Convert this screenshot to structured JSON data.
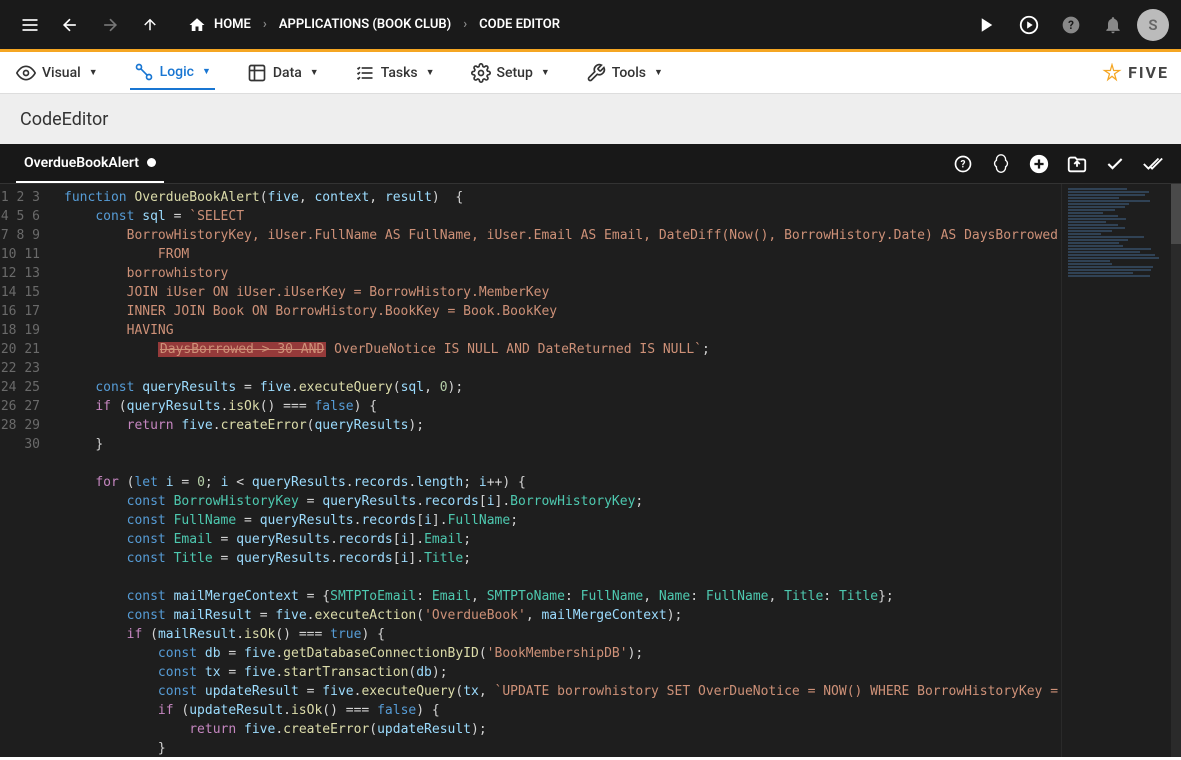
{
  "topbar": {
    "breadcrumb": [
      {
        "icon": "home",
        "label": "HOME"
      },
      {
        "label": "APPLICATIONS (BOOK CLUB)"
      },
      {
        "label": "CODE EDITOR"
      }
    ],
    "avatar_letter": "S"
  },
  "menubar": {
    "items": [
      {
        "icon": "eye",
        "label": "Visual"
      },
      {
        "icon": "nodes",
        "label": "Logic",
        "active": true
      },
      {
        "icon": "grid",
        "label": "Data"
      },
      {
        "icon": "tasks",
        "label": "Tasks"
      },
      {
        "icon": "gear",
        "label": "Setup"
      },
      {
        "icon": "tools",
        "label": "Tools"
      }
    ],
    "logo": "FIVE"
  },
  "subheader": "CodeEditor",
  "editor": {
    "tab": "OverdueBookAlert",
    "lineStart": 1,
    "lineEnd": 30,
    "code": [
      {
        "indent": 0,
        "tokens": [
          [
            "k",
            "function "
          ],
          [
            "fnn",
            "OverdueBookAlert"
          ],
          [
            "op",
            "("
          ],
          [
            "p",
            "five"
          ],
          [
            "op",
            ", "
          ],
          [
            "p",
            "context"
          ],
          [
            "op",
            ", "
          ],
          [
            "p",
            "result"
          ],
          [
            "op",
            ")  {"
          ]
        ]
      },
      {
        "indent": 1,
        "tokens": [
          [
            "k",
            "const "
          ],
          [
            "p",
            "sql"
          ],
          [
            "op",
            " = "
          ],
          [
            "s",
            "`SELECT"
          ]
        ]
      },
      {
        "indent": 2,
        "tokens": [
          [
            "s",
            "BorrowHistoryKey, iUser.FullName AS FullName, iUser.Email AS Email, DateDiff(Now(), BorrowHistory.Date) AS DaysBorrowed"
          ]
        ]
      },
      {
        "indent": 3,
        "tokens": [
          [
            "s",
            "FROM"
          ]
        ]
      },
      {
        "indent": 2,
        "tokens": [
          [
            "s",
            "borrowhistory"
          ]
        ]
      },
      {
        "indent": 2,
        "tokens": [
          [
            "s",
            "JOIN iUser ON iUser.iUserKey = BorrowHistory.MemberKey"
          ]
        ]
      },
      {
        "indent": 2,
        "tokens": [
          [
            "s",
            "INNER JOIN Book ON BorrowHistory.BookKey = Book.BookKey"
          ]
        ]
      },
      {
        "indent": 2,
        "tokens": [
          [
            "s",
            "HAVING"
          ]
        ]
      },
      {
        "indent": 3,
        "tokens": [
          [
            "sel",
            "DaysBorrowed > 30 AND"
          ],
          [
            "s",
            " OverDueNotice IS NULL AND DateReturned IS NULL`"
          ],
          [
            "op",
            ";"
          ]
        ]
      },
      {
        "indent": 0,
        "tokens": []
      },
      {
        "indent": 1,
        "tokens": [
          [
            "k",
            "const "
          ],
          [
            "p",
            "queryResults"
          ],
          [
            "op",
            " = "
          ],
          [
            "p",
            "five"
          ],
          [
            "op",
            "."
          ],
          [
            "fnn",
            "executeQuery"
          ],
          [
            "op",
            "("
          ],
          [
            "p",
            "sql"
          ],
          [
            "op",
            ", "
          ],
          [
            "n",
            "0"
          ],
          [
            "op",
            ");"
          ]
        ]
      },
      {
        "indent": 1,
        "tokens": [
          [
            "kw",
            "if"
          ],
          [
            "op",
            " ("
          ],
          [
            "p",
            "queryResults"
          ],
          [
            "op",
            "."
          ],
          [
            "fnn",
            "isOk"
          ],
          [
            "op",
            "() === "
          ],
          [
            "b",
            "false"
          ],
          [
            "op",
            ") {"
          ]
        ]
      },
      {
        "indent": 2,
        "tokens": [
          [
            "kw",
            "return"
          ],
          [
            "op",
            " "
          ],
          [
            "p",
            "five"
          ],
          [
            "op",
            "."
          ],
          [
            "fnn",
            "createError"
          ],
          [
            "op",
            "("
          ],
          [
            "p",
            "queryResults"
          ],
          [
            "op",
            ");"
          ]
        ]
      },
      {
        "indent": 1,
        "tokens": [
          [
            "op",
            "}"
          ]
        ]
      },
      {
        "indent": 0,
        "tokens": []
      },
      {
        "indent": 1,
        "tokens": [
          [
            "kw",
            "for"
          ],
          [
            "op",
            " ("
          ],
          [
            "k",
            "let "
          ],
          [
            "p",
            "i"
          ],
          [
            "op",
            " = "
          ],
          [
            "n",
            "0"
          ],
          [
            "op",
            "; "
          ],
          [
            "p",
            "i"
          ],
          [
            "op",
            " < "
          ],
          [
            "p",
            "queryResults"
          ],
          [
            "op",
            "."
          ],
          [
            "p",
            "records"
          ],
          [
            "op",
            "."
          ],
          [
            "p",
            "length"
          ],
          [
            "op",
            "; "
          ],
          [
            "p",
            "i"
          ],
          [
            "op",
            "++) {"
          ]
        ]
      },
      {
        "indent": 2,
        "tokens": [
          [
            "k",
            "const "
          ],
          [
            "m",
            "BorrowHistoryKey"
          ],
          [
            "op",
            " = "
          ],
          [
            "p",
            "queryResults"
          ],
          [
            "op",
            "."
          ],
          [
            "p",
            "records"
          ],
          [
            "op",
            "["
          ],
          [
            "p",
            "i"
          ],
          [
            "op",
            "]."
          ],
          [
            "m",
            "BorrowHistoryKey"
          ],
          [
            "op",
            ";"
          ]
        ]
      },
      {
        "indent": 2,
        "tokens": [
          [
            "k",
            "const "
          ],
          [
            "m",
            "FullName"
          ],
          [
            "op",
            " = "
          ],
          [
            "p",
            "queryResults"
          ],
          [
            "op",
            "."
          ],
          [
            "p",
            "records"
          ],
          [
            "op",
            "["
          ],
          [
            "p",
            "i"
          ],
          [
            "op",
            "]."
          ],
          [
            "m",
            "FullName"
          ],
          [
            "op",
            ";"
          ]
        ]
      },
      {
        "indent": 2,
        "tokens": [
          [
            "k",
            "const "
          ],
          [
            "m",
            "Email"
          ],
          [
            "op",
            " = "
          ],
          [
            "p",
            "queryResults"
          ],
          [
            "op",
            "."
          ],
          [
            "p",
            "records"
          ],
          [
            "op",
            "["
          ],
          [
            "p",
            "i"
          ],
          [
            "op",
            "]."
          ],
          [
            "m",
            "Email"
          ],
          [
            "op",
            ";"
          ]
        ]
      },
      {
        "indent": 2,
        "tokens": [
          [
            "k",
            "const "
          ],
          [
            "m",
            "Title"
          ],
          [
            "op",
            " = "
          ],
          [
            "p",
            "queryResults"
          ],
          [
            "op",
            "."
          ],
          [
            "p",
            "records"
          ],
          [
            "op",
            "["
          ],
          [
            "p",
            "i"
          ],
          [
            "op",
            "]."
          ],
          [
            "m",
            "Title"
          ],
          [
            "op",
            ";"
          ]
        ]
      },
      {
        "indent": 0,
        "tokens": []
      },
      {
        "indent": 2,
        "tokens": [
          [
            "k",
            "const "
          ],
          [
            "p",
            "mailMergeContext"
          ],
          [
            "op",
            " = {"
          ],
          [
            "m",
            "SMTPToEmail"
          ],
          [
            "op",
            ": "
          ],
          [
            "m",
            "Email"
          ],
          [
            "op",
            ", "
          ],
          [
            "m",
            "SMTPToName"
          ],
          [
            "op",
            ": "
          ],
          [
            "m",
            "FullName"
          ],
          [
            "op",
            ", "
          ],
          [
            "m",
            "Name"
          ],
          [
            "op",
            ": "
          ],
          [
            "m",
            "FullName"
          ],
          [
            "op",
            ", "
          ],
          [
            "m",
            "Title"
          ],
          [
            "op",
            ": "
          ],
          [
            "m",
            "Title"
          ],
          [
            "op",
            "};"
          ]
        ]
      },
      {
        "indent": 2,
        "tokens": [
          [
            "k",
            "const "
          ],
          [
            "p",
            "mailResult"
          ],
          [
            "op",
            " = "
          ],
          [
            "p",
            "five"
          ],
          [
            "op",
            "."
          ],
          [
            "fnn",
            "executeAction"
          ],
          [
            "op",
            "("
          ],
          [
            "s",
            "'OverdueBook'"
          ],
          [
            "op",
            ", "
          ],
          [
            "p",
            "mailMergeContext"
          ],
          [
            "op",
            ");"
          ]
        ]
      },
      {
        "indent": 2,
        "tokens": [
          [
            "kw",
            "if"
          ],
          [
            "op",
            " ("
          ],
          [
            "p",
            "mailResult"
          ],
          [
            "op",
            "."
          ],
          [
            "fnn",
            "isOk"
          ],
          [
            "op",
            "() === "
          ],
          [
            "b",
            "true"
          ],
          [
            "op",
            ") {"
          ]
        ]
      },
      {
        "indent": 3,
        "tokens": [
          [
            "k",
            "const "
          ],
          [
            "p",
            "db"
          ],
          [
            "op",
            " = "
          ],
          [
            "p",
            "five"
          ],
          [
            "op",
            "."
          ],
          [
            "fnn",
            "getDatabaseConnectionByID"
          ],
          [
            "op",
            "("
          ],
          [
            "s",
            "'BookMembershipDB'"
          ],
          [
            "op",
            ");"
          ]
        ]
      },
      {
        "indent": 3,
        "tokens": [
          [
            "k",
            "const "
          ],
          [
            "p",
            "tx"
          ],
          [
            "op",
            " = "
          ],
          [
            "p",
            "five"
          ],
          [
            "op",
            "."
          ],
          [
            "fnn",
            "startTransaction"
          ],
          [
            "op",
            "("
          ],
          [
            "p",
            "db"
          ],
          [
            "op",
            ");"
          ]
        ]
      },
      {
        "indent": 3,
        "tokens": [
          [
            "k",
            "const "
          ],
          [
            "p",
            "updateResult"
          ],
          [
            "op",
            " = "
          ],
          [
            "p",
            "five"
          ],
          [
            "op",
            "."
          ],
          [
            "fnn",
            "executeQuery"
          ],
          [
            "op",
            "("
          ],
          [
            "p",
            "tx"
          ],
          [
            "op",
            ", "
          ],
          [
            "s",
            "`UPDATE borrowhistory SET OverDueNotice = NOW() WHERE BorrowHistoryKey ="
          ]
        ]
      },
      {
        "indent": 3,
        "tokens": [
          [
            "kw",
            "if"
          ],
          [
            "op",
            " ("
          ],
          [
            "p",
            "updateResult"
          ],
          [
            "op",
            "."
          ],
          [
            "fnn",
            "isOk"
          ],
          [
            "op",
            "() === "
          ],
          [
            "b",
            "false"
          ],
          [
            "op",
            ") {"
          ]
        ]
      },
      {
        "indent": 4,
        "tokens": [
          [
            "kw",
            "return"
          ],
          [
            "op",
            " "
          ],
          [
            "p",
            "five"
          ],
          [
            "op",
            "."
          ],
          [
            "fnn",
            "createError"
          ],
          [
            "op",
            "("
          ],
          [
            "p",
            "updateResult"
          ],
          [
            "op",
            ");"
          ]
        ]
      },
      {
        "indent": 3,
        "tokens": [
          [
            "op",
            "}"
          ]
        ]
      }
    ]
  }
}
